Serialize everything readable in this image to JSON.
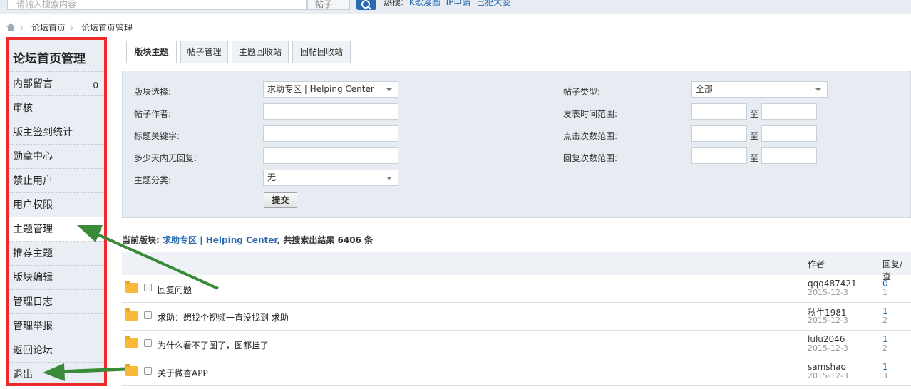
{
  "topbar": {
    "search_placeholder": "请输入搜索内容",
    "search_type": "帖子",
    "hot_label": "热搜:",
    "hot_links": [
      "K歌漫画",
      "IP申请",
      "已犯大姿"
    ]
  },
  "breadcrumb": {
    "items": [
      "论坛首页",
      "论坛首页管理"
    ]
  },
  "sidebar": {
    "title": "论坛首页管理",
    "items": [
      {
        "label": "内部留言",
        "count": "0"
      },
      {
        "label": "审核"
      },
      {
        "label": "版主签到统计"
      },
      {
        "label": "勋章中心"
      },
      {
        "label": "禁止用户"
      },
      {
        "label": "用户权限"
      },
      {
        "label": "主题管理"
      },
      {
        "label": "推荐主题"
      },
      {
        "label": "版块编辑"
      },
      {
        "label": "管理日志"
      },
      {
        "label": "管理举报"
      },
      {
        "label": "返回论坛"
      },
      {
        "label": "退出"
      }
    ]
  },
  "tabs": [
    "版块主题",
    "帖子管理",
    "主题回收站",
    "回帖回收站"
  ],
  "filter": {
    "board_label": "版块选择:",
    "board_value": "求助专区 | Helping Center",
    "author_label": "帖子作者:",
    "keyword_label": "标题关键字:",
    "noreply_label": "多少天内无回复:",
    "category_label": "主题分类:",
    "category_value": "无",
    "type_label": "帖子类型:",
    "type_value": "全部",
    "time_label": "发表时间范围:",
    "clicks_label": "点击次数范围:",
    "replies_label": "回复次数范围:",
    "to_label": "至",
    "submit_label": "提交"
  },
  "summary": {
    "prefix": "当前版块:",
    "board": "求助专区 | Helping Center",
    "suffix": ", 共搜索出结果 6406 条"
  },
  "table": {
    "author_header": "作者",
    "replies_header": "回复/查",
    "rows": [
      {
        "title": "回复问题",
        "author": "qqq487421",
        "date": "2015-12-3",
        "replies": "0",
        "views": "1"
      },
      {
        "title": "求助：想找个视频一直没找到 求助",
        "author": "秋生1981",
        "date": "2015-12-3",
        "replies": "1",
        "views": "2"
      },
      {
        "title": "为什么看不了图了，图都挂了",
        "author": "lulu2046",
        "date": "2015-12-3",
        "replies": "1",
        "views": "2"
      },
      {
        "title": "关于微杏APP",
        "author": "samshao",
        "date": "2015-12-3",
        "replies": "1",
        "views": "3"
      }
    ]
  },
  "colors": {
    "highlight_border": "#ee2b2b",
    "arrow": "#3a8a3a",
    "link": "#2a6ab0"
  }
}
